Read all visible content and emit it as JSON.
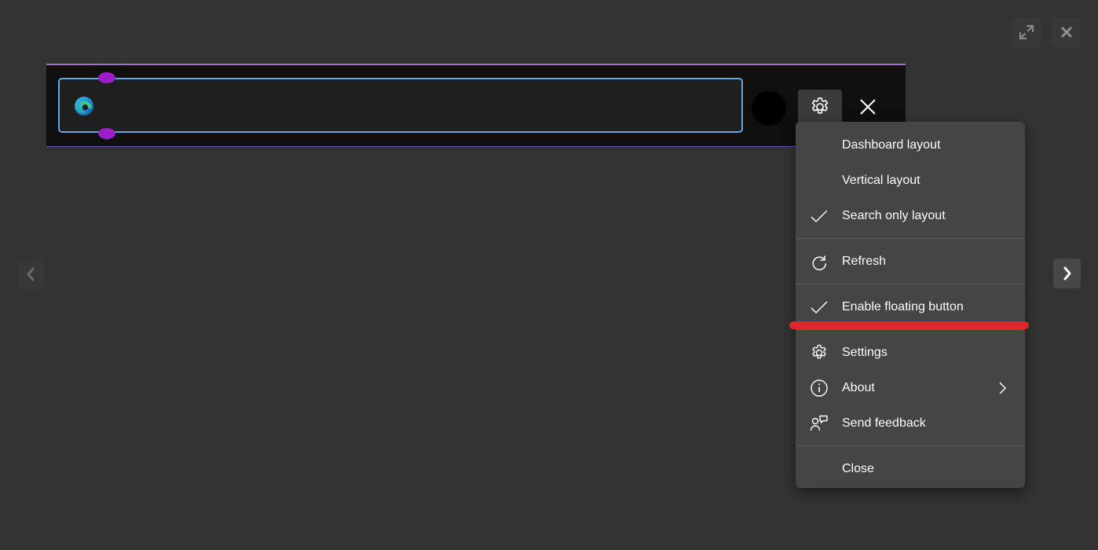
{
  "viewer": {
    "expand_icon": "expand-arrows-icon",
    "close_icon": "close-x-icon",
    "prev_icon": "chevron-left-icon",
    "next_icon": "chevron-right-icon"
  },
  "search_bar": {
    "input_value": "",
    "placeholder": "",
    "logo_icon": "edge-logo-icon",
    "settings_icon": "gear-icon",
    "close_icon": "close-icon"
  },
  "menu": {
    "items": [
      {
        "label": "Dashboard layout",
        "icon": null,
        "checked": false
      },
      {
        "label": "Vertical layout",
        "icon": null,
        "checked": false
      },
      {
        "label": "Search only layout",
        "icon": "check-icon",
        "checked": true
      },
      {
        "label": "Refresh",
        "icon": "refresh-icon"
      },
      {
        "label": "Enable floating button",
        "icon": "check-icon",
        "checked": true
      },
      {
        "label": "Settings",
        "icon": "gear-icon"
      },
      {
        "label": "About",
        "icon": "info-icon",
        "submenu": true
      },
      {
        "label": "Send feedback",
        "icon": "feedback-icon"
      },
      {
        "label": "Close",
        "icon": null
      }
    ]
  },
  "colors": {
    "background": "#333333",
    "searchbar_bg": "#0f0f10",
    "searchbar_accent": "#a070d0",
    "input_border": "#5fa8e0",
    "handle": "#9d1ec8",
    "menu_bg": "#454545",
    "annotation_red": "#e0262a"
  }
}
